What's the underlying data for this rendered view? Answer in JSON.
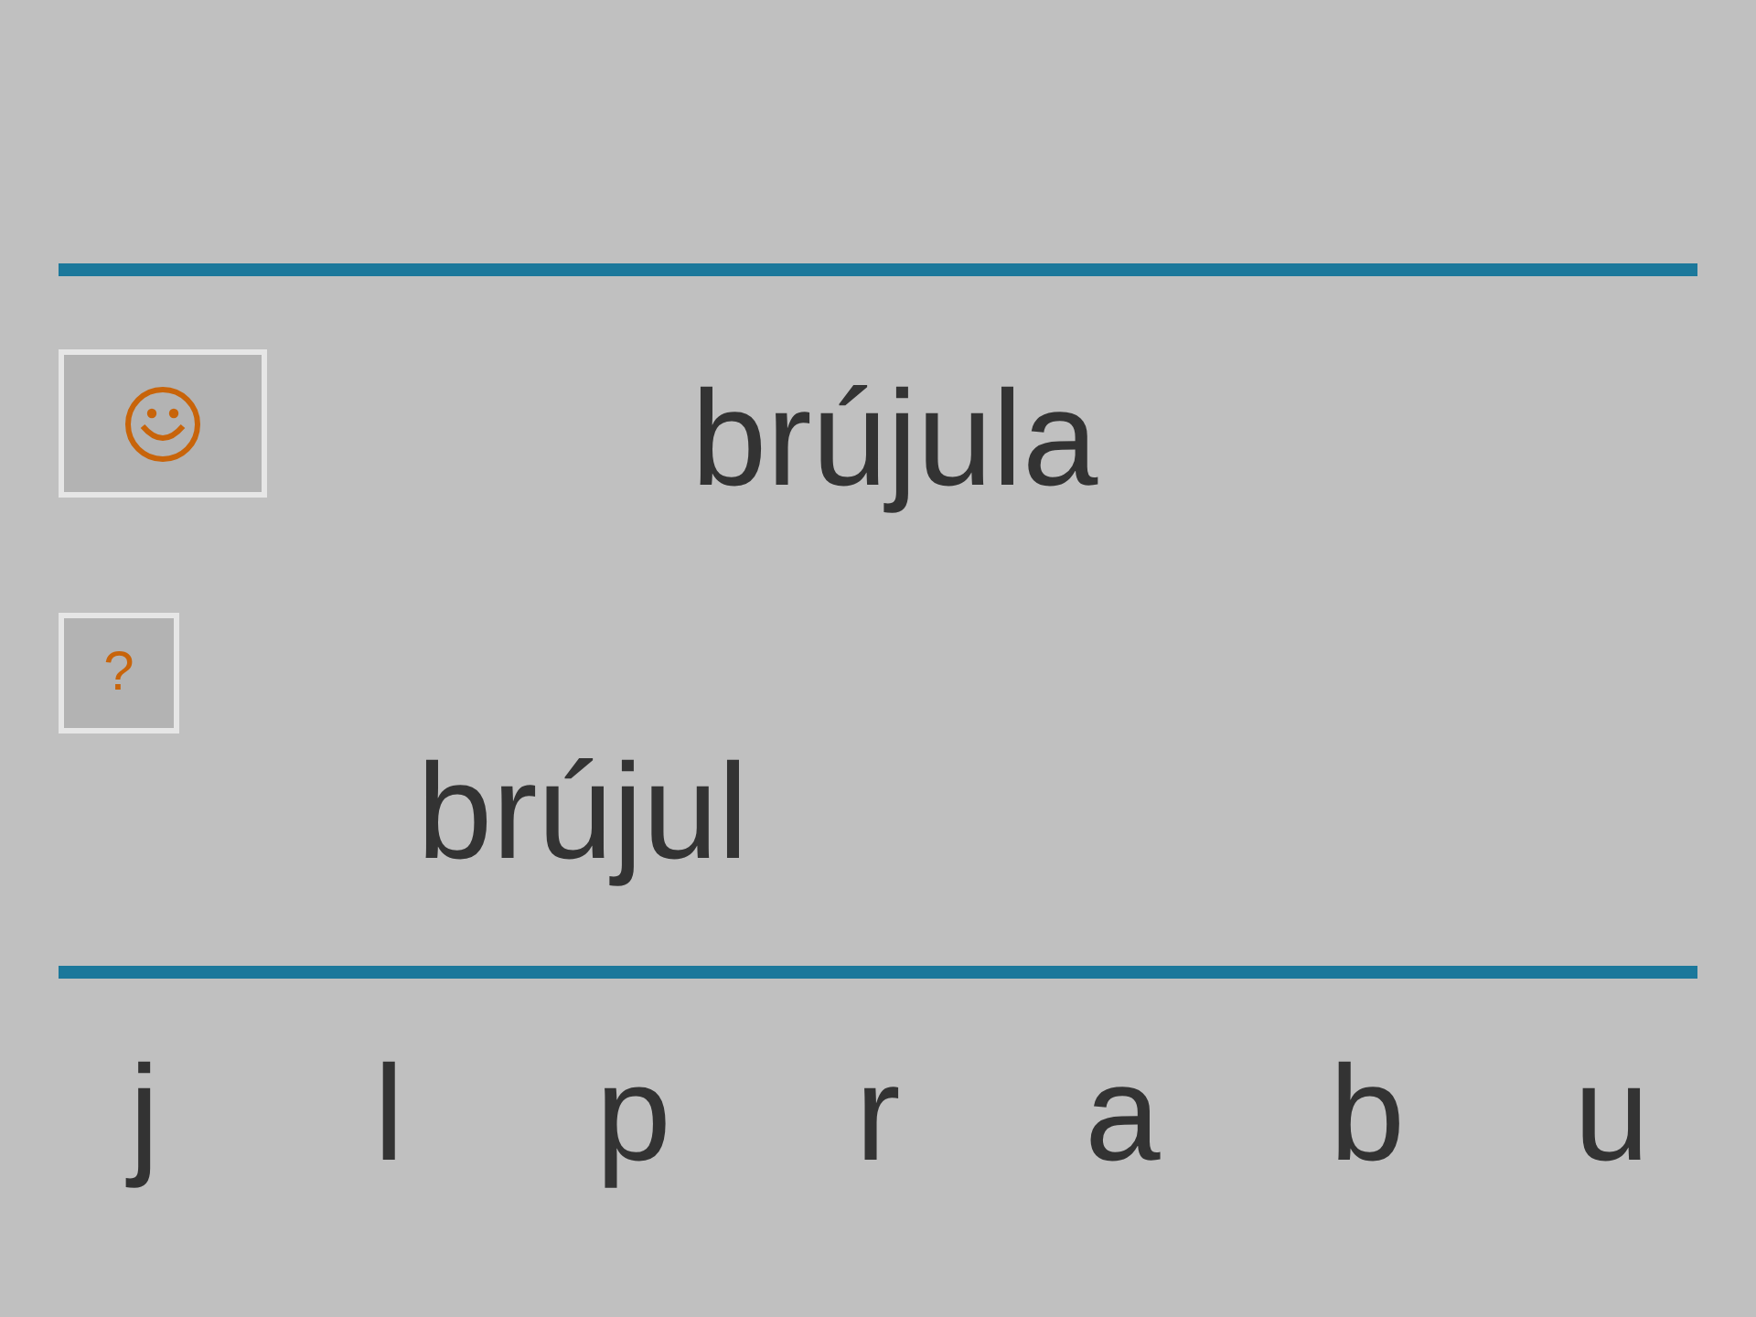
{
  "target_word": "brújula",
  "hint_button": {
    "label": "?"
  },
  "attempt": "brújul",
  "letters": [
    "j",
    "l",
    "p",
    "r",
    "a",
    "b",
    "u"
  ]
}
